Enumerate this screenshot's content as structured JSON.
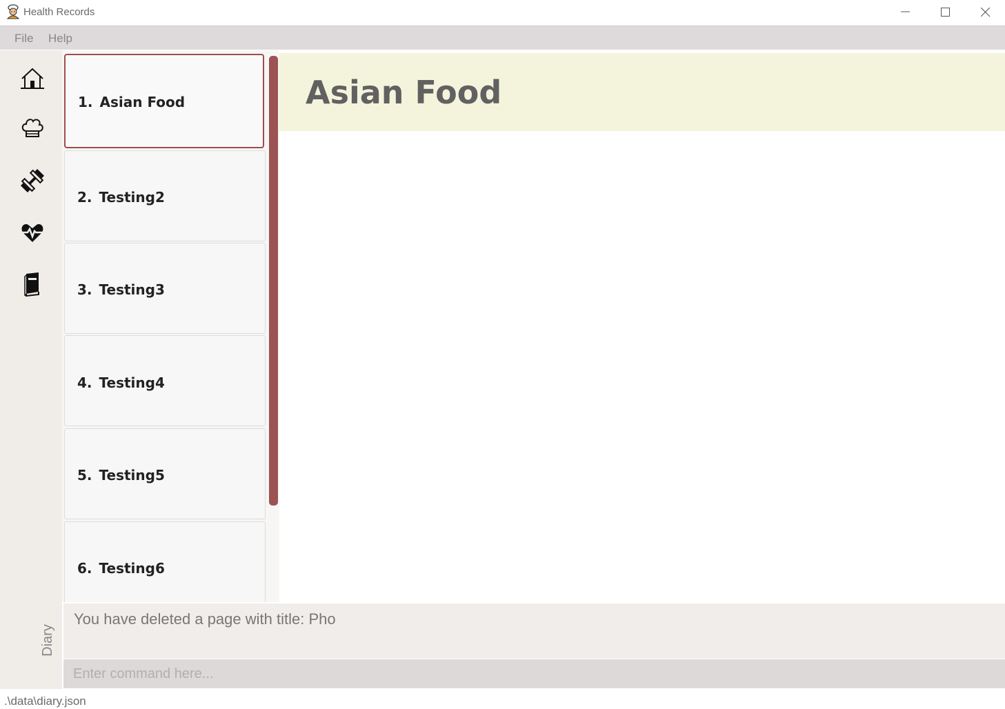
{
  "window": {
    "title": "Health Records",
    "icon": "chef-avatar-icon",
    "controls": [
      "minimize-icon",
      "maximize-icon",
      "close-icon"
    ]
  },
  "menu": {
    "file": "File",
    "help": "Help"
  },
  "sidebar": {
    "icons": [
      "home-icon",
      "chef-hat-icon",
      "dumbbell-icon",
      "heartbeat-icon",
      "diary-book-icon"
    ],
    "label": "Diary"
  },
  "list": {
    "items": [
      {
        "index": "1.",
        "title": "Asian Food",
        "selected": true
      },
      {
        "index": "2.",
        "title": "Testing2",
        "selected": false
      },
      {
        "index": "3.",
        "title": "Testing3",
        "selected": false
      },
      {
        "index": "4.",
        "title": "Testing4",
        "selected": false
      },
      {
        "index": "5.",
        "title": "Testing5",
        "selected": false
      },
      {
        "index": "6.",
        "title": "Testing6",
        "selected": false
      }
    ]
  },
  "main": {
    "title": "Asian Food"
  },
  "result": {
    "message": "You have deleted a page with title: Pho"
  },
  "command": {
    "placeholder": "Enter command here..."
  },
  "status": {
    "file_path": ".\\data\\diary.json"
  },
  "colors": {
    "accent": "#9b5353",
    "banner": "#f4f4dc",
    "sidebar": "#f0ede8",
    "menubar": "#dedadb"
  }
}
